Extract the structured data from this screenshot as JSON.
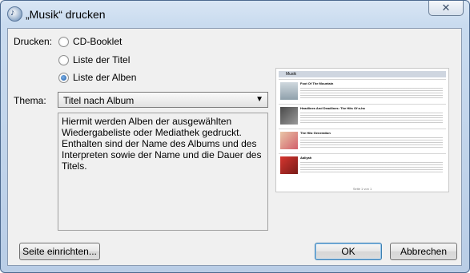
{
  "window": {
    "title": "„Musik“ drucken",
    "close_glyph": "✕"
  },
  "print_label": "Drucken:",
  "options": [
    {
      "label": "CD-Booklet",
      "checked": false
    },
    {
      "label": "Liste der Titel",
      "checked": false
    },
    {
      "label": "Liste der Alben",
      "checked": true
    }
  ],
  "theme_label": "Thema:",
  "theme_value": "Titel nach Album",
  "description": "Hiermit werden Alben der ausgewählten Wiedergabeliste oder Mediathek gedruckt. Enthalten sind der Name des Albums und des Interpreten sowie der Name und die Dauer des Titels.",
  "preview": {
    "header": "Musik",
    "albums": [
      "Foot Of The Mountain",
      "Headlines And Deadlines: The Hits Of a-ha",
      "The Hitz Generation",
      "Aaliyah"
    ],
    "footer": "Seite 1 von 1"
  },
  "buttons": {
    "page_setup": "Seite einrichten...",
    "ok": "OK",
    "cancel": "Abbrechen"
  }
}
